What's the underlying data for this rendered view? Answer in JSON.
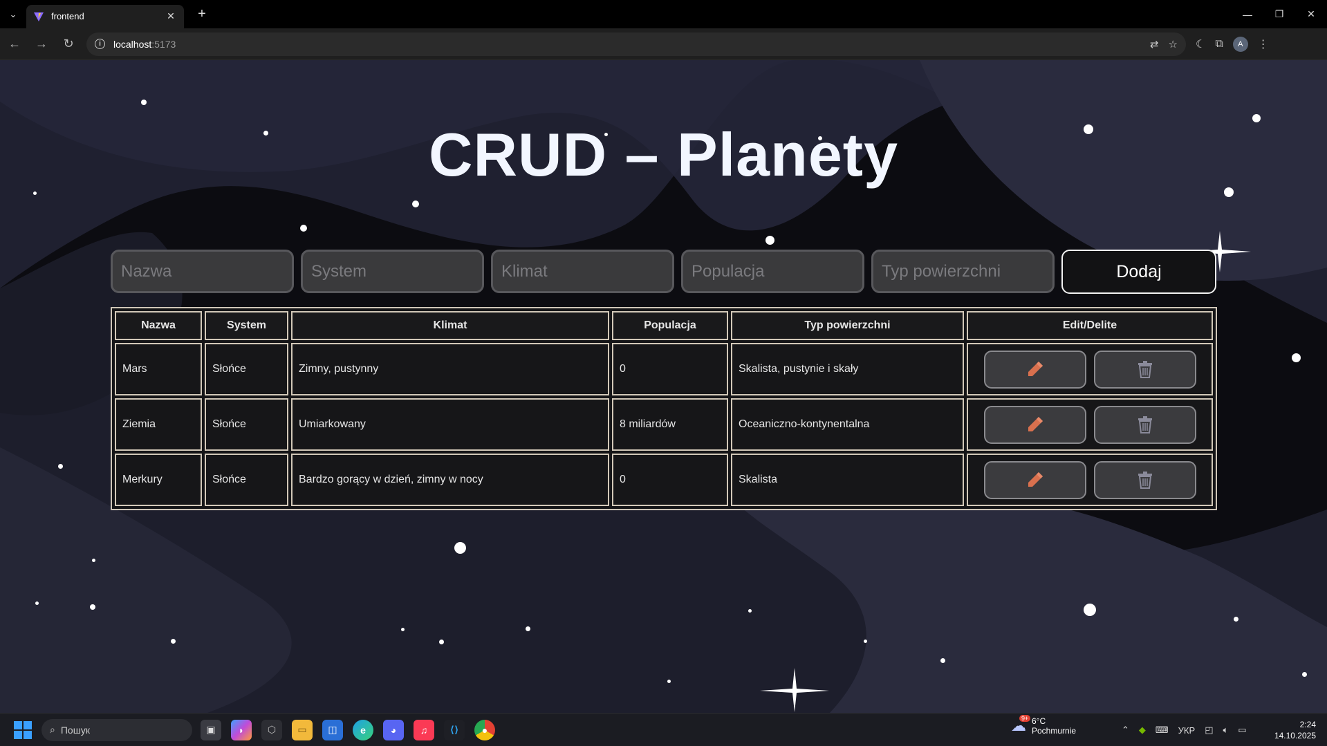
{
  "browser": {
    "tab_title": "frontend",
    "url_host": "localhost",
    "url_port": ":5173",
    "profile_initial": "A"
  },
  "page": {
    "title": "CRUD – Planety",
    "form": {
      "name_placeholder": "Nazwa",
      "system_placeholder": "System",
      "climate_placeholder": "Klimat",
      "population_placeholder": "Populacja",
      "surface_placeholder": "Typ powierzchni",
      "add_label": "Dodaj"
    },
    "table": {
      "headers": [
        "Nazwa",
        "System",
        "Klimat",
        "Populacja",
        "Typ powierzchni",
        "Edit/Delite"
      ],
      "rows": [
        {
          "name": "Mars",
          "system": "Słońce",
          "climate": "Zimny, pustynny",
          "population": "0",
          "surface": "Skalista, pustynie i skały"
        },
        {
          "name": "Ziemia",
          "system": "Słońce",
          "climate": "Umiarkowany",
          "population": "8 miliardów",
          "surface": "Oceaniczno-kontynentalna"
        },
        {
          "name": "Merkury",
          "system": "Słońce",
          "climate": "Bardzo gorący w dzień, zimny w nocy",
          "population": "0",
          "surface": "Skalista"
        }
      ]
    }
  },
  "taskbar": {
    "search_label": "Пошук",
    "weather_temp": "6°C",
    "weather_desc": "Pochmurnie",
    "weather_badge": "9+",
    "language": "УКР",
    "time": "2:24",
    "date": "14.10.2025"
  },
  "colors": {
    "accent_pencil": "#d9704e",
    "accent_trash": "#8a8a9a"
  }
}
